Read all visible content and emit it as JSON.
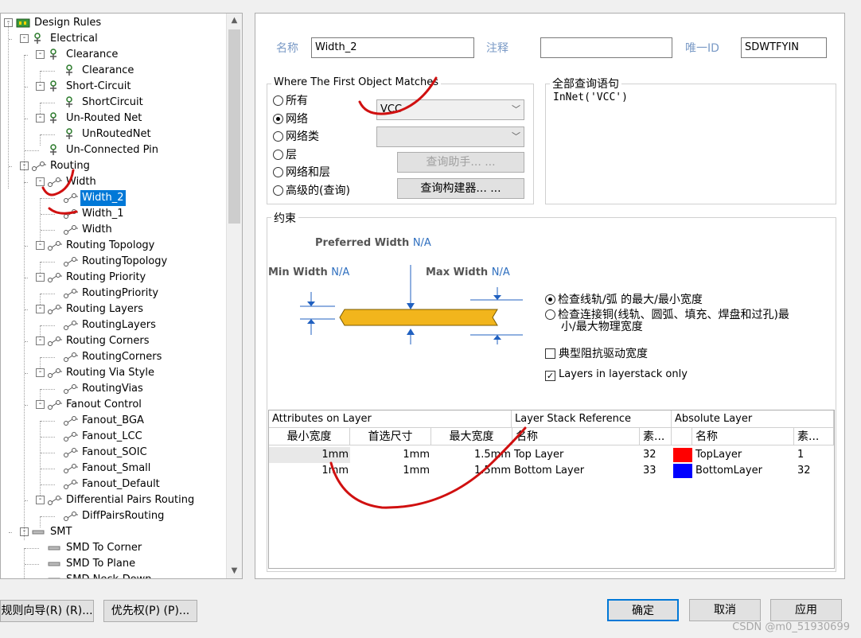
{
  "tree": {
    "items": [
      {
        "label": "Design Rules",
        "level": 0,
        "exp": "-",
        "icon": "rules"
      },
      {
        "label": "Electrical",
        "level": 1,
        "exp": "-",
        "icon": "cat"
      },
      {
        "label": "Clearance",
        "level": 2,
        "exp": "-",
        "icon": "cat"
      },
      {
        "label": "Clearance",
        "level": 3,
        "exp": "",
        "icon": "rule"
      },
      {
        "label": "Short-Circuit",
        "level": 2,
        "exp": "-",
        "icon": "cat"
      },
      {
        "label": "ShortCircuit",
        "level": 3,
        "exp": "",
        "icon": "rule"
      },
      {
        "label": "Un-Routed Net",
        "level": 2,
        "exp": "-",
        "icon": "cat"
      },
      {
        "label": "UnRoutedNet",
        "level": 3,
        "exp": "",
        "icon": "rule"
      },
      {
        "label": "Un-Connected Pin",
        "level": 2,
        "exp": "",
        "icon": "cat"
      },
      {
        "label": "Routing",
        "level": 1,
        "exp": "-",
        "icon": "route"
      },
      {
        "label": "Width",
        "level": 2,
        "exp": "-",
        "icon": "route"
      },
      {
        "label": "Width_2",
        "level": 3,
        "exp": "",
        "icon": "route",
        "selected": true
      },
      {
        "label": "Width_1",
        "level": 3,
        "exp": "",
        "icon": "route"
      },
      {
        "label": "Width",
        "level": 3,
        "exp": "",
        "icon": "route"
      },
      {
        "label": "Routing Topology",
        "level": 2,
        "exp": "-",
        "icon": "route"
      },
      {
        "label": "RoutingTopology",
        "level": 3,
        "exp": "",
        "icon": "route"
      },
      {
        "label": "Routing Priority",
        "level": 2,
        "exp": "-",
        "icon": "route"
      },
      {
        "label": "RoutingPriority",
        "level": 3,
        "exp": "",
        "icon": "route"
      },
      {
        "label": "Routing Layers",
        "level": 2,
        "exp": "-",
        "icon": "route"
      },
      {
        "label": "RoutingLayers",
        "level": 3,
        "exp": "",
        "icon": "route"
      },
      {
        "label": "Routing Corners",
        "level": 2,
        "exp": "-",
        "icon": "route"
      },
      {
        "label": "RoutingCorners",
        "level": 3,
        "exp": "",
        "icon": "route"
      },
      {
        "label": "Routing Via Style",
        "level": 2,
        "exp": "-",
        "icon": "route"
      },
      {
        "label": "RoutingVias",
        "level": 3,
        "exp": "",
        "icon": "route"
      },
      {
        "label": "Fanout Control",
        "level": 2,
        "exp": "-",
        "icon": "route"
      },
      {
        "label": "Fanout_BGA",
        "level": 3,
        "exp": "",
        "icon": "route"
      },
      {
        "label": "Fanout_LCC",
        "level": 3,
        "exp": "",
        "icon": "route"
      },
      {
        "label": "Fanout_SOIC",
        "level": 3,
        "exp": "",
        "icon": "route"
      },
      {
        "label": "Fanout_Small",
        "level": 3,
        "exp": "",
        "icon": "route"
      },
      {
        "label": "Fanout_Default",
        "level": 3,
        "exp": "",
        "icon": "route"
      },
      {
        "label": "Differential Pairs Routing",
        "level": 2,
        "exp": "-",
        "icon": "route"
      },
      {
        "label": "DiffPairsRouting",
        "level": 3,
        "exp": "",
        "icon": "route"
      },
      {
        "label": "SMT",
        "level": 1,
        "exp": "-",
        "icon": "smt"
      },
      {
        "label": "SMD To Corner",
        "level": 2,
        "exp": "",
        "icon": "smt"
      },
      {
        "label": "SMD To Plane",
        "level": 2,
        "exp": "",
        "icon": "smt"
      },
      {
        "label": "SMD Neck-Down",
        "level": 2,
        "exp": "",
        "icon": "smt"
      }
    ]
  },
  "header": {
    "name_label": "名称",
    "name_value": "Width_2",
    "comment_label": "注释",
    "comment_value": "",
    "uid_label": "唯一ID",
    "uid_value": "SDWTFYIN"
  },
  "match": {
    "title": "Where The First Object Matches",
    "options": [
      "所有",
      "网络",
      "网络类",
      "层",
      "网络和层",
      "高级的(查询)"
    ],
    "selected": 1,
    "net_value": "VCC",
    "class_value": "",
    "query_helper": "查询助手... ...",
    "query_builder": "查询构建器... ..."
  },
  "full_query": {
    "title": "全部查询语句",
    "text": "InNet('VCC')"
  },
  "constraints": {
    "title": "约束",
    "preferred_label": "Preferred Width",
    "preferred_value": "N/A",
    "min_label": "Min Width",
    "min_value": "N/A",
    "max_label": "Max Width",
    "max_value": "N/A",
    "radio1": "检查线轨/弧 的最大/最小宽度",
    "radio2_line1": "检查连接铜(线轨、圆弧、填充、焊盘和过孔)最",
    "radio2_line2": "小/最大物理宽度",
    "check1": "典型阻抗驱动宽度",
    "check2": "Layers in layerstack only",
    "check1_on": false,
    "check2_on": true
  },
  "table": {
    "group1": "Attributes on Layer",
    "group2": "Layer Stack Reference",
    "group3": "Absolute Layer",
    "cols": [
      "最小宽度",
      "首选尺寸",
      "最大宽度",
      "名称",
      "素...",
      "名称",
      "素..."
    ],
    "rows": [
      {
        "min": "1mm",
        "pref": "1mm",
        "max": "1.5mm",
        "name": "Top Layer",
        "idx": "32",
        "color": "#ff0000",
        "abs": "TopLayer",
        "absidx": "1"
      },
      {
        "min": "1mm",
        "pref": "1mm",
        "max": "1.5mm",
        "name": "Bottom Layer",
        "idx": "33",
        "color": "#0000ff",
        "abs": "BottomLayer",
        "absidx": "32"
      }
    ]
  },
  "footer": {
    "wizard": "规则向导(R) (R)...",
    "priority": "优先权(P) (P)...",
    "ok": "确定",
    "cancel": "取消",
    "apply": "应用",
    "watermark": "CSDN @m0_51930699"
  },
  "colors": {
    "trace": "#f2b51c",
    "selection": "#0078d7",
    "annotation": "#d01010"
  }
}
